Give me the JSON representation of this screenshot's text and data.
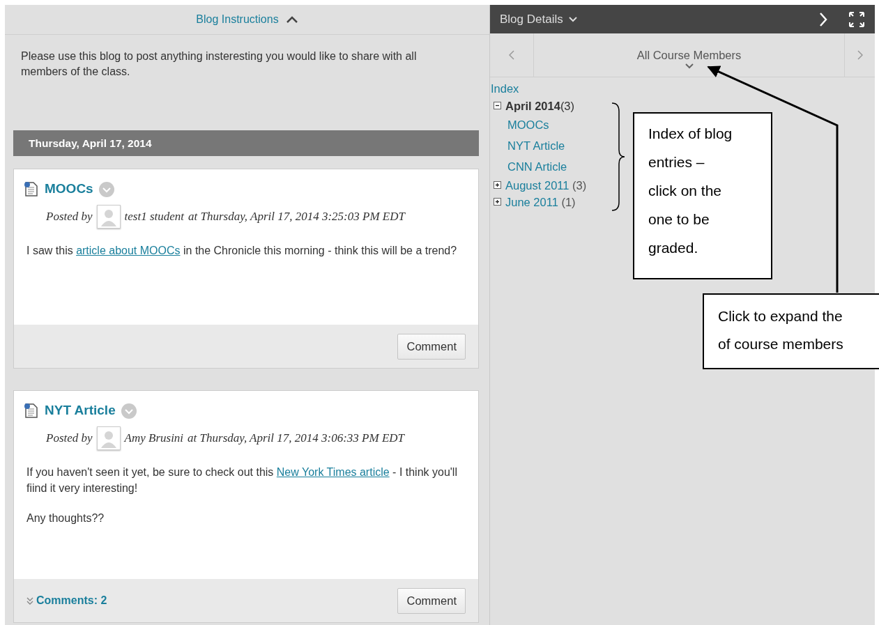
{
  "instructions": {
    "title": "Blog Instructions",
    "expanded": true,
    "text": "Please use this blog to post anything insteresting you would like to share with all members of the class."
  },
  "date_heading": "Thursday, April 17, 2014",
  "posts": [
    {
      "title": "MOOCs",
      "posted_by": "Posted by",
      "author": "test1 student",
      "timestamp": "at Thursday, April 17, 2014 3:25:03 PM EDT",
      "paragraphs": [
        [
          {
            "text": "I saw this "
          },
          {
            "text": "article about MOOCs",
            "link": true
          },
          {
            "text": " in the Chronicle this morning - think this will be a trend?"
          }
        ]
      ],
      "button": "Comment"
    },
    {
      "title": "NYT Article",
      "posted_by": "Posted by",
      "author": "Amy Brusini",
      "timestamp": "at Thursday, April 17, 2014 3:06:33 PM EDT",
      "paragraphs": [
        [
          {
            "text": "If you haven't seen it yet, be sure to check out this "
          },
          {
            "text": "New York Times article",
            "link": true
          },
          {
            "text": " - I think you'll fiind it very interesting!"
          }
        ],
        [
          {
            "text": "Any thoughts??"
          }
        ]
      ],
      "comments": "Comments: 2",
      "button": "Comment"
    }
  ],
  "details": {
    "title": "Blog Details",
    "member_filter": "All Course Members",
    "index_label": "Index",
    "index": [
      {
        "label": "April 2014",
        "count": "(3)",
        "expanded": true,
        "children": [
          {
            "label": "MOOCs"
          },
          {
            "label": "NYT Article"
          },
          {
            "label": "CNN Article"
          }
        ]
      },
      {
        "label": "August 2011",
        "count": "(3)",
        "expanded": false
      },
      {
        "label": "June 2011",
        "count": "(1)",
        "expanded": false
      }
    ]
  },
  "annotations": [
    {
      "kind": "brace",
      "lines": [
        "Index of blog",
        "entries –",
        "click on the",
        "one to be",
        "graded."
      ]
    },
    {
      "kind": "arrow",
      "lines": [
        "Click to expand the",
        "of course members"
      ]
    }
  ]
}
